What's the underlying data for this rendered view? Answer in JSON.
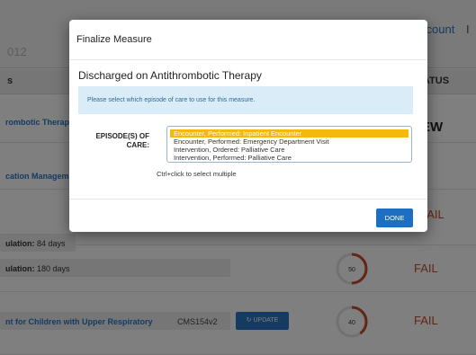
{
  "background": {
    "header_year": "012",
    "account_label": "ccount",
    "account_label_2": "I",
    "table_head_left": "s",
    "table_head_status": "TATUS",
    "rows": [
      {
        "link": "rombotic Therap"
      },
      {
        "link": "cation Managem"
      },
      {
        "field_label": "ulation:",
        "field_value": "84 days",
        "status": "FAIL"
      },
      {
        "field_label": "ulation:",
        "field_value": "180 days",
        "status": "FAIL",
        "gauge": "50"
      },
      {
        "link": "nt for Children with Upper Respiratory",
        "code": "CMS154v2",
        "update_label": "↻ UPDATE",
        "status": "FAIL",
        "gauge": "40"
      }
    ],
    "review_partial": "EW"
  },
  "modal": {
    "title": "Finalize Measure",
    "measure_name": "Discharged on Antithrombotic Therapy",
    "info_text": "Please select which episode of care to use for this measure.",
    "episode_label": "EPISODE(S) OF CARE:",
    "options": [
      "Encounter, Performed: Inpatient Encounter",
      "Encounter, Performed: Emergency Department Visit",
      "Intervention, Ordered: Palliative Care",
      "Intervention, Performed: Palliative Care"
    ],
    "selected_index": 0,
    "hint": "Ctrl+click to select multiple",
    "done_label": "DONE"
  },
  "colors": {
    "accent": "#1e6fc2",
    "selected_option": "#f5b80c",
    "fail": "#c64a2a",
    "info_bg": "#d9ecf7"
  },
  "chart_data": {
    "type": "gauge",
    "gauges": [
      {
        "label": "50",
        "value": 50,
        "max": 100
      },
      {
        "label": "40",
        "value": 40,
        "max": 100
      }
    ]
  }
}
